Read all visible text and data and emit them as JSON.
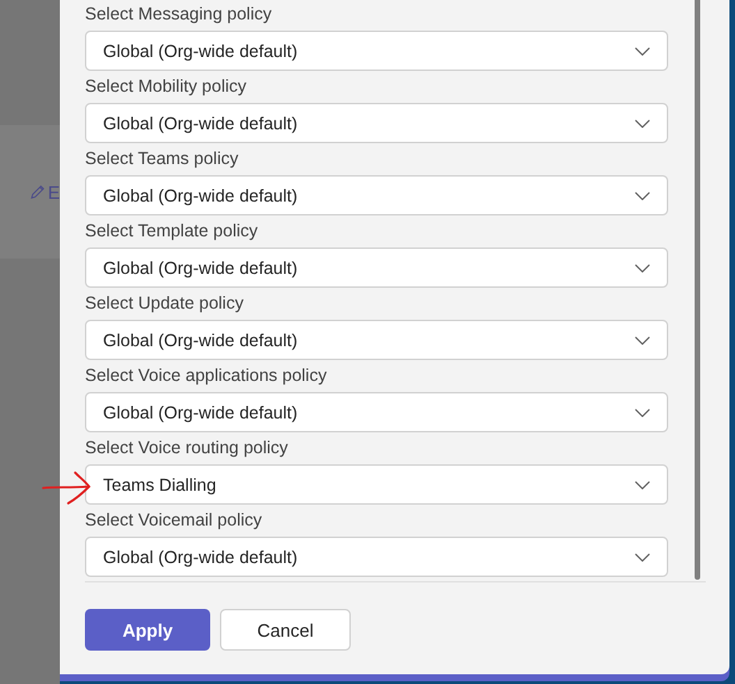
{
  "background": {
    "edit_link": {
      "text": "E"
    }
  },
  "policies": [
    {
      "label": "Select Messaging policy",
      "value": "Global (Org-wide default)"
    },
    {
      "label": "Select Mobility policy",
      "value": "Global (Org-wide default)"
    },
    {
      "label": "Select Teams policy",
      "value": "Global (Org-wide default)"
    },
    {
      "label": "Select Template policy",
      "value": "Global (Org-wide default)"
    },
    {
      "label": "Select Update policy",
      "value": "Global (Org-wide default)"
    },
    {
      "label": "Select Voice applications policy",
      "value": "Global (Org-wide default)"
    },
    {
      "label": "Select Voice routing policy",
      "value": "Teams Dialling"
    },
    {
      "label": "Select Voicemail policy",
      "value": "Global (Org-wide default)"
    }
  ],
  "buttons": [
    {
      "label": "Apply",
      "kind": "primary"
    },
    {
      "label": "Cancel",
      "kind": "secondary"
    }
  ]
}
